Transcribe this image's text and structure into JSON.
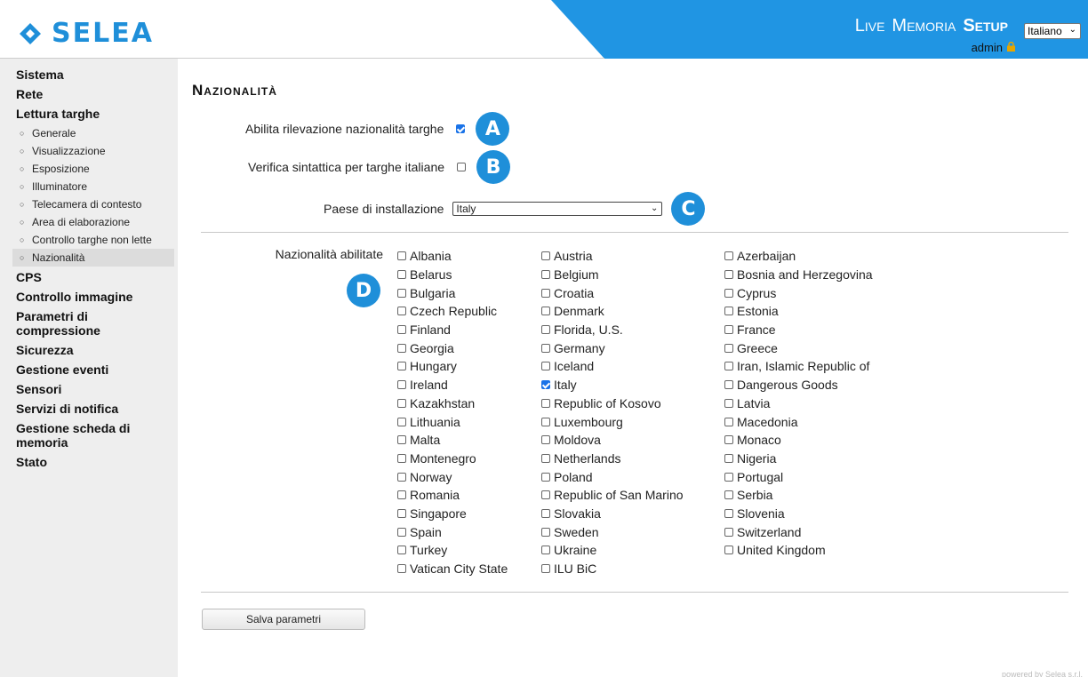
{
  "brand": {
    "name": "SELEA"
  },
  "topnav": {
    "live": "Live",
    "memoria": "Memoria",
    "setup": "Setup"
  },
  "language": {
    "selected": "Italiano"
  },
  "user": {
    "name": "admin"
  },
  "sidebar": {
    "sistema": "Sistema",
    "rete": "Rete",
    "lettura": "Lettura targhe",
    "lettura_sub": [
      "Generale",
      "Visualizzazione",
      "Esposizione",
      "Illuminatore",
      "Telecamera di contesto",
      "Area di elaborazione",
      "Controllo targhe non lette",
      "Nazionalità"
    ],
    "cps": "CPS",
    "controllo": "Controllo immagine",
    "parametri": "Parametri di compressione",
    "sicurezza": "Sicurezza",
    "eventi": "Gestione eventi",
    "sensori": "Sensori",
    "servizi": "Servizi di notifica",
    "scheda": "Gestione scheda di memoria",
    "stato": "Stato"
  },
  "main": {
    "title": "Nazionalità",
    "enable_label": "Abilita rilevazione nazionalità targhe",
    "enable_checked": true,
    "verify_label": "Verifica sintattica per targhe italiane",
    "verify_checked": false,
    "country_label": "Paese di installazione",
    "country_value": "Italy",
    "nat_label": "Nazionalità abilitate",
    "badges": {
      "a": "A",
      "b": "B",
      "c": "C",
      "d": "D"
    },
    "col1": [
      "Albania",
      "Belarus",
      "Bulgaria",
      "Czech Republic",
      "Finland",
      "Georgia",
      "Hungary",
      "Ireland",
      "Kazakhstan",
      "Lithuania",
      "Malta",
      "Montenegro",
      "Norway",
      "Romania",
      "Singapore",
      "Spain",
      "Turkey",
      "Vatican City State"
    ],
    "col2": [
      "Austria",
      "Belgium",
      "Croatia",
      "Denmark",
      "Florida, U.S.",
      "Germany",
      "Iceland",
      "Italy",
      "Republic of Kosovo",
      "Luxembourg",
      "Moldova",
      "Netherlands",
      "Poland",
      "Republic of San Marino",
      "Slovakia",
      "Sweden",
      "Ukraine",
      "ILU BiC"
    ],
    "col3": [
      "Azerbaijan",
      "Bosnia and Herzegovina",
      "Cyprus",
      "Estonia",
      "France",
      "Greece",
      "Iran, Islamic Republic of",
      "Dangerous Goods",
      "Latvia",
      "Macedonia",
      "Monaco",
      "Nigeria",
      "Portugal",
      "Serbia",
      "Slovenia",
      "Switzerland",
      "United Kingdom"
    ],
    "checked_nationalities": [
      "Italy"
    ],
    "save_label": "Salva parametri",
    "powered": "powered by Selea s.r.l."
  },
  "colors": {
    "accent": "#2095e3",
    "badge": "#1f8fd9",
    "sidebar_bg": "#eeeeee"
  }
}
